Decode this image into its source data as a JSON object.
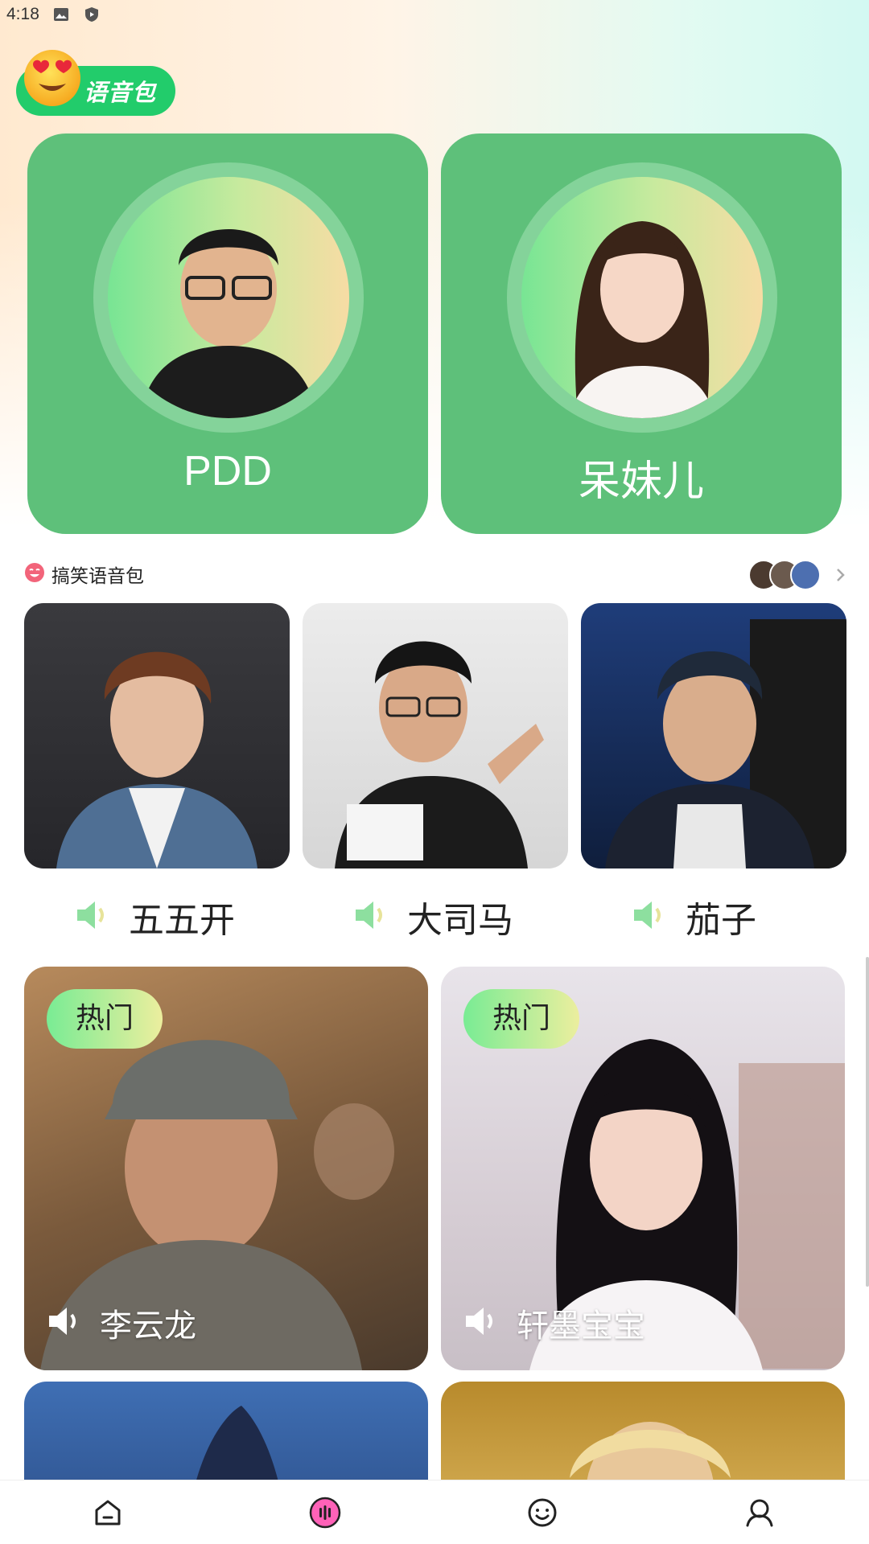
{
  "status_bar": {
    "time": "4:18",
    "icons": [
      "image-icon",
      "shield-play-icon"
    ]
  },
  "header": {
    "badge_label": "语音包",
    "badge_icon": "heart-eyes-emoji-icon",
    "accent_color": "#22cc6b"
  },
  "featured": [
    {
      "name": "PDD"
    },
    {
      "name": "呆妹儿"
    }
  ],
  "funny_section": {
    "title": "搞笑语音包",
    "title_icon": "laughing-face-icon",
    "more_icon": "chevron-right-icon",
    "items": [
      {
        "name": "五五开",
        "icon": "speaker-icon"
      },
      {
        "name": "大司马",
        "icon": "speaker-icon"
      },
      {
        "name": "茄子",
        "icon": "speaker-icon"
      }
    ]
  },
  "hot_section": {
    "items": [
      {
        "badge": "热门",
        "name": "李云龙",
        "icon": "speaker-icon"
      },
      {
        "badge": "热门",
        "name": "轩墨宝宝",
        "icon": "speaker-icon"
      }
    ]
  },
  "bottom_nav": {
    "items": [
      {
        "icon": "home-icon",
        "active": false
      },
      {
        "icon": "voice-icon",
        "active": true
      },
      {
        "icon": "smiley-icon",
        "active": false
      },
      {
        "icon": "profile-icon",
        "active": false
      }
    ],
    "active_color": "#ff62b8"
  }
}
